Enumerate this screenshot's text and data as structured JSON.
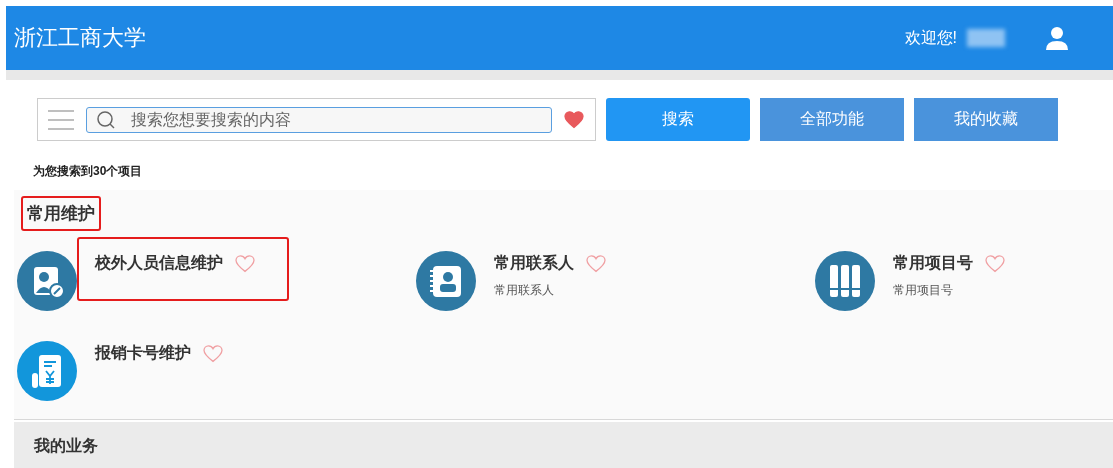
{
  "header": {
    "title": "浙江工商大学",
    "welcome": "欢迎您!"
  },
  "search": {
    "placeholder": "搜索您想要搜索的内容",
    "favorite": true,
    "buttons": [
      {
        "label": "搜索",
        "kind": "primary"
      },
      {
        "label": "全部功能",
        "kind": "secondary"
      },
      {
        "label": "我的收藏",
        "kind": "secondary"
      }
    ]
  },
  "result_count": "为您搜索到**30**个项目",
  "section": {
    "title": "常用维护",
    "highlighted": true,
    "items": [
      {
        "title": "校外人员信息维护",
        "kind": "person-wrench",
        "color": "#2e79a3",
        "favorite": false,
        "highlighted": true
      },
      {
        "title": "常用联系人",
        "subtitle": "常用联系人",
        "kind": "contact-book",
        "color": "#2e79a3",
        "favorite": false,
        "highlighted": false
      },
      {
        "title": "常用项目号",
        "subtitle": "常用项目号",
        "kind": "binders",
        "color": "#2e79a3",
        "favorite": false,
        "highlighted": false
      },
      {
        "title": "报销卡号维护",
        "kind": "receipt",
        "color": "#1296db",
        "favorite": false,
        "highlighted": false
      }
    ]
  },
  "next_section": {
    "title": "我的业务"
  }
}
